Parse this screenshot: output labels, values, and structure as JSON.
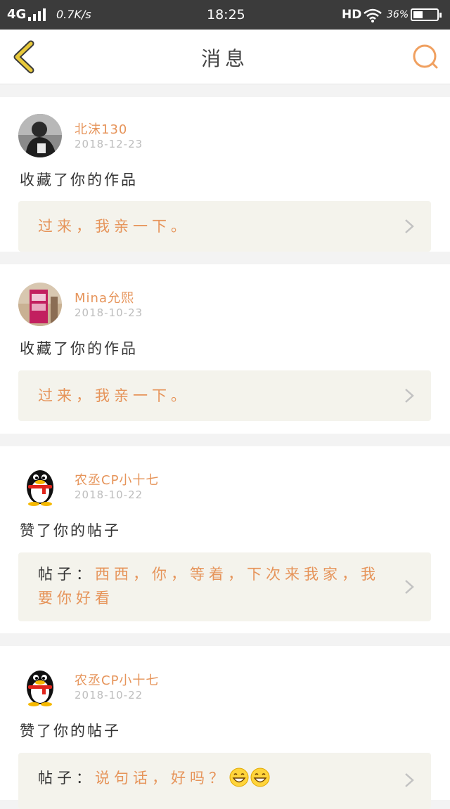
{
  "status_bar": {
    "carrier": "4G",
    "net_speed": "0.7K/s",
    "time": "18:25",
    "hd": "HD",
    "battery_pct": "36%"
  },
  "header": {
    "title": "消息"
  },
  "colors": {
    "accent": "#e6945a",
    "quote_bg": "#f4f3ec",
    "back_icon": "#e8c93a"
  },
  "messages": [
    {
      "username": "北沫130",
      "date": "2018-12-23",
      "action": "收藏了你的作品",
      "quote_prefix": "",
      "quote": "过来，我亲一下。"
    },
    {
      "username": "Mina允熙",
      "date": "2018-10-23",
      "action": "收藏了你的作品",
      "quote_prefix": "",
      "quote": "过来，我亲一下。"
    },
    {
      "username": "农丞CP小十七",
      "date": "2018-10-22",
      "action": "赞了你的帖子",
      "quote_prefix": "帖子：",
      "quote": "西西，你，等着，下次来我家，我要你好看"
    },
    {
      "username": "农丞CP小十七",
      "date": "2018-10-22",
      "action": "赞了你的帖子",
      "quote_prefix": "帖子：",
      "quote": "说句话，好吗？"
    }
  ]
}
